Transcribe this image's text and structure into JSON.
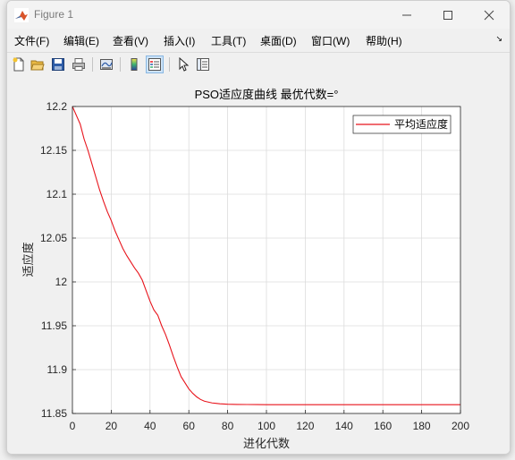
{
  "window": {
    "title": "Figure 1",
    "minimize_icon": "minimize-icon",
    "maximize_icon": "maximize-icon",
    "close_icon": "close-icon"
  },
  "menubar": {
    "items": [
      "文件(F)",
      "编辑(E)",
      "查看(V)",
      "插入(I)",
      "工具(T)",
      "桌面(D)",
      "窗口(W)",
      "帮助(H)"
    ]
  },
  "toolbar": {
    "buttons": [
      "new-figure-icon",
      "open-file-icon",
      "save-icon",
      "print-icon",
      "link-plot-icon",
      "insert-colorbar-icon",
      "insert-legend-icon",
      "edit-plot-arrow-icon",
      "property-inspector-icon"
    ]
  },
  "chart_data": {
    "type": "line",
    "title": "PSO适应度曲线  最优代数=°",
    "xlabel": "进化代数",
    "ylabel": "适应度",
    "xlim": [
      0,
      200
    ],
    "ylim": [
      11.85,
      12.2
    ],
    "xticks": [
      "0",
      "20",
      "40",
      "60",
      "80",
      "100",
      "120",
      "140",
      "160",
      "180",
      "200"
    ],
    "yticks": [
      "11.85",
      "11.9",
      "11.95",
      "12",
      "12.05",
      "12.1",
      "12.15",
      "12.2"
    ],
    "grid": true,
    "legend": "top-right",
    "series": [
      {
        "name": "平均适应度",
        "color": "#e8141c",
        "x": [
          0,
          2,
          4,
          6,
          8,
          10,
          12,
          14,
          16,
          18,
          20,
          22,
          24,
          26,
          28,
          30,
          32,
          34,
          36,
          38,
          40,
          42,
          44,
          46,
          48,
          50,
          52,
          54,
          56,
          58,
          60,
          62,
          64,
          66,
          68,
          70,
          72,
          74,
          76,
          78,
          80,
          85,
          90,
          95,
          100,
          110,
          120,
          140,
          160,
          180,
          200
        ],
        "y": [
          12.2,
          12.19,
          12.18,
          12.163,
          12.15,
          12.135,
          12.12,
          12.105,
          12.092,
          12.08,
          12.07,
          12.058,
          12.048,
          12.038,
          12.03,
          12.023,
          12.016,
          12.01,
          12.002,
          11.99,
          11.978,
          11.968,
          11.962,
          11.95,
          11.94,
          11.928,
          11.915,
          11.903,
          11.892,
          11.885,
          11.878,
          11.873,
          11.869,
          11.866,
          11.864,
          11.863,
          11.862,
          11.8615,
          11.861,
          11.8608,
          11.8605,
          11.8603,
          11.8602,
          11.8601,
          11.86,
          11.86,
          11.86,
          11.86,
          11.86,
          11.86,
          11.86
        ]
      }
    ]
  }
}
